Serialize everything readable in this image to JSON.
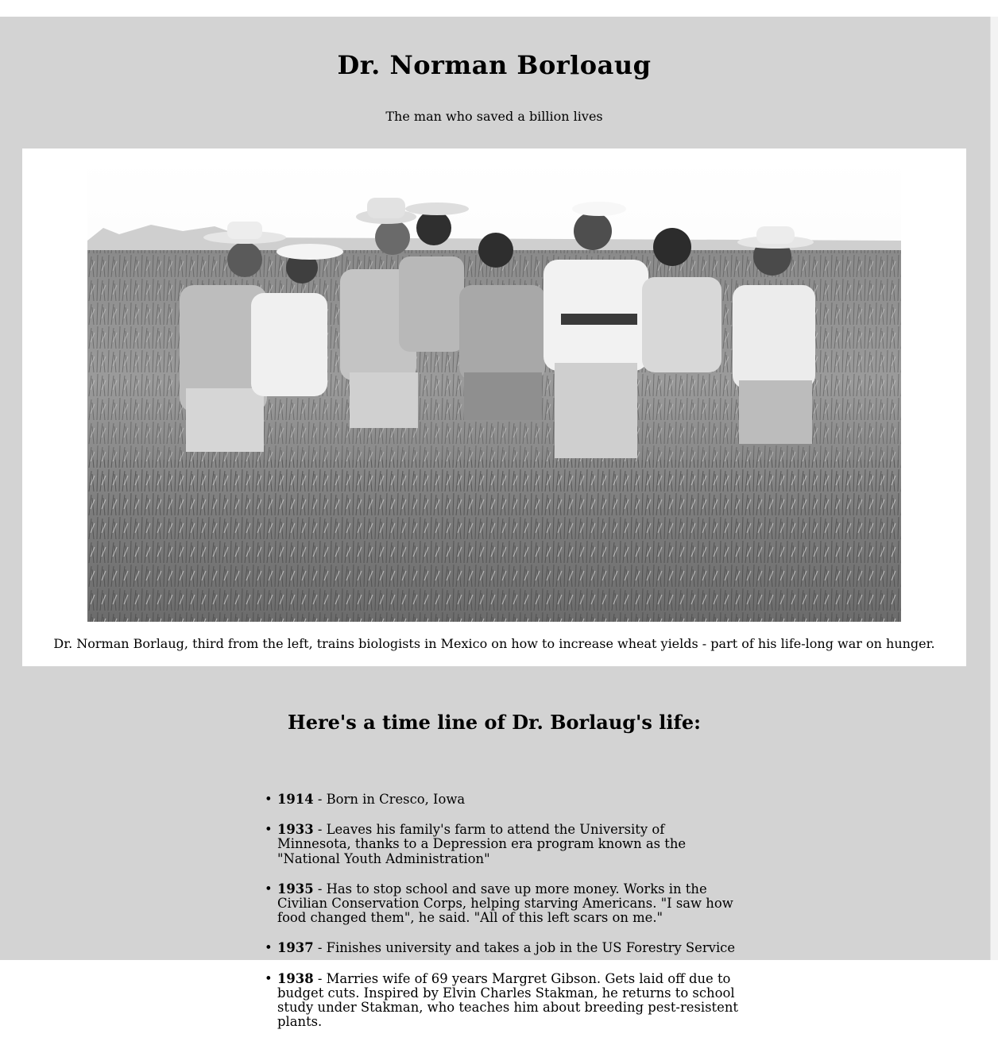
{
  "page": {
    "title": "Dr. Norman Borloaug",
    "tagline": "The man who saved a billion lives"
  },
  "image": {
    "caption": "Dr. Norman Borlaug, third from the left, trains biologists in Mexico on how to increase wheat yields - part of his life-long war on hunger."
  },
  "tribute": {
    "heading": "Here's a time line of Dr. Borlaug's life:",
    "items": [
      {
        "year": "1914",
        "text": " - Born in Cresco, Iowa"
      },
      {
        "year": "1933",
        "text": " - Leaves his family's farm to attend the University of Minnesota, thanks to a Depression era program known as the \"National Youth Administration\""
      },
      {
        "year": "1935",
        "text": " - Has to stop school and save up more money. Works in the Civilian Conservation Corps, helping starving Americans. \"I saw how food changed them\", he said. \"All of this left scars on me.\""
      },
      {
        "year": "1937",
        "text": " - Finishes university and takes a job in the US Forestry Service"
      },
      {
        "year": "1938",
        "text": " - Marries wife of 69 years Margret Gibson. Gets laid off due to budget cuts. Inspired by Elvin Charles Stakman, he returns to school study under Stakman, who teaches him about breeding pest-resistent plants."
      }
    ]
  },
  "colors": {
    "page_background": "#d3d3d3",
    "image_panel": "#ffffff"
  }
}
